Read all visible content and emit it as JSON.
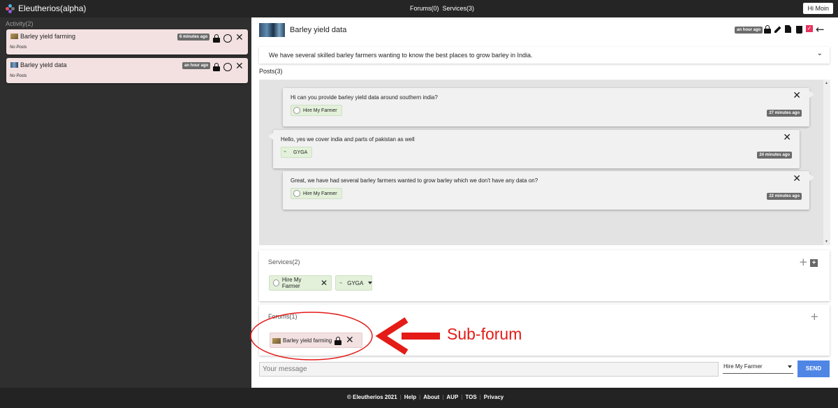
{
  "app": {
    "title": "Eleutherios(alpha)",
    "user_label": "Hi Moin"
  },
  "nav": {
    "forums": "Forums(0)",
    "services": "Services(3)"
  },
  "activity": {
    "label": "Activity(2)",
    "items": [
      {
        "title": "Barley yield farming",
        "time": "6 minutes ago",
        "sub": "No Posts"
      },
      {
        "title": "Barley yield data",
        "time": "an hour ago",
        "sub": "No Posts"
      }
    ]
  },
  "forum": {
    "title": "Barley yield data",
    "time": "an hour ago",
    "description": "We have several skilled barley farmers wanting to know the best places to grow barley in India."
  },
  "posts": {
    "label": "Posts(3)",
    "items": [
      {
        "text": "Hi can you provide barley yield data around southern india?",
        "service": "Hire My Farmer",
        "time": "27 minutes ago"
      },
      {
        "text": "Hello, yes we cover india and parts of pakistan as well",
        "service": "GYGA",
        "time": "24 minutes ago"
      },
      {
        "text": "Great, we have had several barley farmers wanted to grow barley which we don't have any data on?",
        "service": "Hire My Farmer",
        "time": "22 minutes ago"
      }
    ]
  },
  "services": {
    "label": "Services(2)",
    "items": [
      "Hire My Farmer",
      "GYGA"
    ]
  },
  "subforums": {
    "label": "Forums(1)",
    "items": [
      "Barley yield farming"
    ]
  },
  "composer": {
    "placeholder": "Your message",
    "selected_service": "Hire My Farmer",
    "send_label": "SEND"
  },
  "footer": {
    "copyright": "© Eleutherios 2021",
    "links": [
      "Help",
      "About",
      "AUP",
      "TOS",
      "Privacy"
    ]
  },
  "annotation": {
    "label": "Sub-forum",
    "color": "#e41b17"
  },
  "colors": {
    "forum_pink": "#f3e1e1",
    "service_green": "#e3f0da",
    "send_blue": "#4f86e6",
    "check_pink": "#e8335e"
  }
}
